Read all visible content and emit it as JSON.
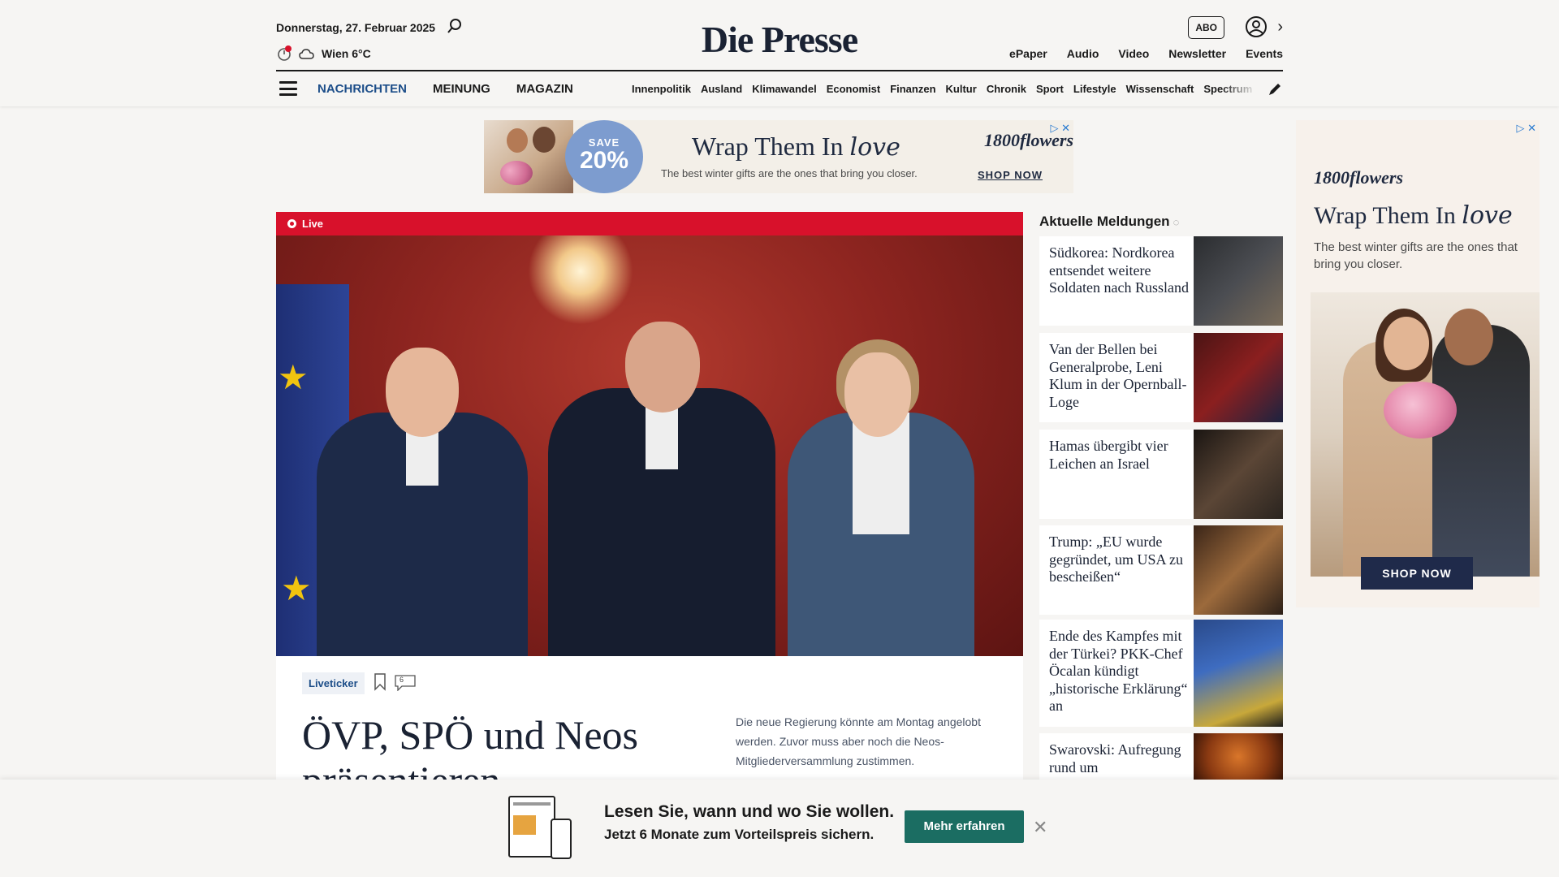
{
  "header": {
    "date": "Donnerstag, 27. Februar 2025",
    "weather": "Wien 6°C",
    "logo": "Die Presse",
    "abo_label": "ABO",
    "topnav": [
      "ePaper",
      "Audio",
      "Video",
      "Newsletter",
      "Events"
    ],
    "mainnav": [
      "NACHRICHTEN",
      "MEINUNG",
      "MAGAZIN"
    ],
    "subnav": [
      "Innenpolitik",
      "Ausland",
      "Klimawandel",
      "Economist",
      "Finanzen",
      "Kultur",
      "Chronik",
      "Sport",
      "Lifestyle",
      "Wissenschaft",
      "Spectrum"
    ]
  },
  "ad_top": {
    "save_label": "SAVE",
    "save_value": "20%",
    "headline": "Wrap Them In",
    "script_word": "love",
    "subtext": "The best winter gifts are the ones that bring you closer.",
    "brand": "1800flowers",
    "cta": "SHOP NOW"
  },
  "hero": {
    "live_label": "Live",
    "tag": "Liveticker",
    "comment_count": "6",
    "headline": "ÖVP, SPÖ und Neos präsentieren",
    "teaser": "Die neue Regierung könnte am Montag angelobt werden. Zuvor muss aber noch die Neos-Mitgliederversammlung zustimmen."
  },
  "sidebar": {
    "title": "Aktuelle Meldungen",
    "items": [
      {
        "text": "Südkorea: Nordkorea entsendet weitere Soldaten nach Russland"
      },
      {
        "text": "Van der Bellen bei Generalprobe, Leni Klum in der Opernball-Loge"
      },
      {
        "text": "Hamas übergibt vier Leichen an Israel"
      },
      {
        "text": "Trump: „EU wurde gegründet, um USA zu bescheißen“"
      },
      {
        "text": "Ende des Kampfes mit der Türkei? PKK-Chef Öcalan kündigt „historische Erklärung“ an"
      },
      {
        "text": "Swarovski: Aufregung rund um"
      }
    ]
  },
  "ad_right": {
    "brand": "1800flowers",
    "headline": "Wrap Them In",
    "script_word": "love",
    "subtext": "The best winter gifts are the ones that bring you closer.",
    "cta": "SHOP NOW"
  },
  "promo": {
    "line1": "Lesen Sie, wann und wo Sie wollen.",
    "line2": "Jetzt 6 Monate zum Vorteilspreis sichern.",
    "button": "Mehr erfahren",
    "close": "✕"
  },
  "colors": {
    "live_red": "#d8112b",
    "nav_blue": "#1d4e89",
    "promo_green": "#1b6d62"
  }
}
